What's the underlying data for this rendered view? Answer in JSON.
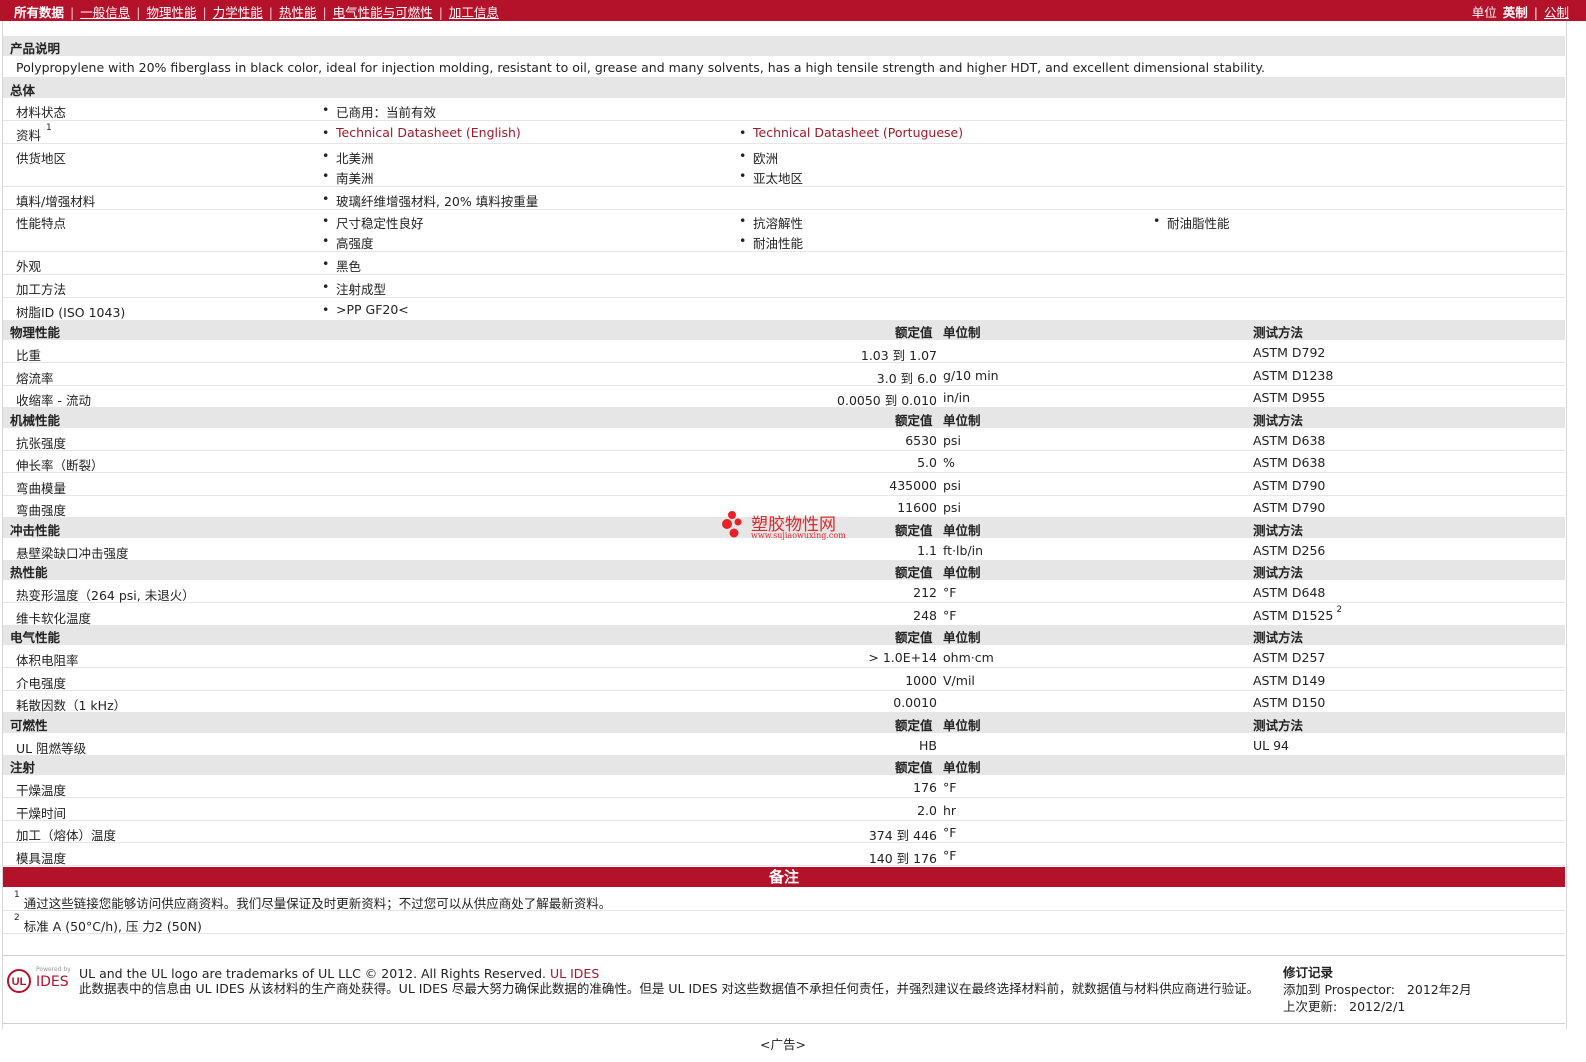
{
  "topnav": {
    "tabs": [
      "所有数据",
      "一般信息",
      "物理性能",
      "力学性能",
      "热性能",
      "电气性能与可燃性",
      "加工信息"
    ],
    "unit_label": "单位",
    "unit_selected": "英制",
    "unit_other": "公制"
  },
  "description": {
    "header": "产品说明",
    "text": "Polypropylene with 20% fiberglass in black color, ideal for injection molding, resistant to oil, grease and many solvents, has a high tensile strength and higher HDT, and excellent dimensional stability."
  },
  "general": {
    "header": "总体",
    "rows": [
      {
        "label": "材料状态",
        "items": [
          "已商用：当前有效"
        ]
      },
      {
        "label": "资料",
        "label_sup": "1",
        "links": [
          "Technical Datasheet (English)",
          "Technical Datasheet (Portuguese)"
        ]
      },
      {
        "label": "供货地区",
        "items": [
          "北美洲",
          "欧洲",
          "南美洲",
          "亚太地区"
        ]
      },
      {
        "label": "填料/增强材料",
        "items": [
          "玻璃纤维增强材料, 20% 填料按重量"
        ]
      },
      {
        "label": "性能特点",
        "items": [
          "尺寸稳定性良好",
          "抗溶解性",
          "耐油脂性能",
          "高强度",
          "耐油性能"
        ]
      },
      {
        "label": "外观",
        "items": [
          "黑色"
        ]
      },
      {
        "label": "加工方法",
        "items": [
          "注射成型"
        ]
      },
      {
        "label": "树脂ID (ISO 1043)",
        "items": [
          ">PP GF20<"
        ]
      }
    ]
  },
  "column_headers": {
    "value": "额定值",
    "unit": "单位制",
    "method": "测试方法"
  },
  "sections": [
    {
      "title": "物理性能",
      "method_header": true,
      "rows": [
        {
          "name": "比重",
          "value": "1.03 到  1.07",
          "unit": "",
          "method": "ASTM D792"
        },
        {
          "name": "熔流率",
          "value": "3.0 到  6.0",
          "unit": "g/10 min",
          "method": "ASTM D1238"
        },
        {
          "name": "收缩率  - 流动",
          "value": "0.0050 到  0.010",
          "unit": "in/in",
          "method": "ASTM D955"
        }
      ]
    },
    {
      "title": "机械性能",
      "method_header": true,
      "rows": [
        {
          "name": "抗张强度",
          "value": "6530",
          "unit": "psi",
          "method": "ASTM D638"
        },
        {
          "name": "伸长率（断裂）",
          "value": "5.0",
          "unit": "%",
          "method": "ASTM D638"
        },
        {
          "name": "弯曲模量",
          "value": "435000",
          "unit": "psi",
          "method": "ASTM D790"
        },
        {
          "name": "弯曲强度",
          "value": "11600",
          "unit": "psi",
          "method": "ASTM D790"
        }
      ]
    },
    {
      "title": "冲击性能",
      "method_header": true,
      "rows": [
        {
          "name": "悬壁梁缺口冲击强度",
          "value": "1.1",
          "unit": "ft·lb/in",
          "method": "ASTM D256"
        }
      ]
    },
    {
      "title": "热性能",
      "method_header": true,
      "rows": [
        {
          "name": "热变形温度（264 psi, 未退火）",
          "value": "212",
          "unit": "°F",
          "method": "ASTM D648"
        },
        {
          "name": "维卡软化温度",
          "value": "248",
          "unit": "°F",
          "method": "ASTM D1525",
          "method_sup": "2"
        }
      ]
    },
    {
      "title": "电气性能",
      "method_header": true,
      "rows": [
        {
          "name": "体积电阻率",
          "value": "> 1.0E+14",
          "unit": "ohm·cm",
          "method": "ASTM D257"
        },
        {
          "name": "介电强度",
          "value": "1000",
          "unit": "V/mil",
          "method": "ASTM D149"
        },
        {
          "name": "耗散因数（1 kHz）",
          "value": "0.0010",
          "unit": "",
          "method": "ASTM D150"
        }
      ]
    },
    {
      "title": "可燃性",
      "method_header": true,
      "rows": [
        {
          "name": "UL 阻燃等级",
          "value": "HB",
          "unit": "",
          "method": "UL 94"
        }
      ]
    },
    {
      "title": "注射",
      "method_header": false,
      "rows": [
        {
          "name": "干燥温度",
          "value": "176",
          "unit": "°F",
          "method": ""
        },
        {
          "name": "干燥时间",
          "value": "2.0",
          "unit": "hr",
          "method": ""
        },
        {
          "name": "加工（熔体）温度",
          "value": "374 到  446",
          "unit": "°F",
          "method": ""
        },
        {
          "name": "模具温度",
          "value": "140 到  176",
          "unit": "°F",
          "method": ""
        }
      ]
    }
  ],
  "notes": {
    "title": "备注",
    "items": [
      {
        "num": "1",
        "text": "通过这些链接您能够访问供应商资料。我们尽量保证及时更新资料；不过您可以从供应商处了解最新资料。"
      },
      {
        "num": "2",
        "text": "标准  A (50°C/h), 压  力2 (50N)"
      }
    ]
  },
  "watermark": {
    "title": "塑胶物性网",
    "url": "www.sujiaowuxing.com"
  },
  "footer": {
    "logo_small": "Powered by",
    "logo_text": "IDES",
    "trademark": "UL and the UL logo are trademarks of UL LLC © 2012. All Rights Reserved.",
    "trademark_link": "UL IDES",
    "disclaimer": "此数据表中的信息由  UL IDES 从该材料的生产商处获得。UL IDES 尽最大努力确保此数据的准确性。但是  UL IDES 对这些数据值不承担任何责任，并强烈建议在最终选择材料前，就数据值与材料供应商进行验证。",
    "revision_title": "修订记录",
    "revision_added_label": "添加到  Prospector:",
    "revision_added_value": "2012年2月",
    "revision_updated_label": "上次更新:",
    "revision_updated_value": "2012/2/1",
    "ad": "<广告>"
  },
  "colors": {
    "brand_red": "#b4122b",
    "link": "#9b1b2a",
    "header_gray": "#e6e6e6"
  }
}
